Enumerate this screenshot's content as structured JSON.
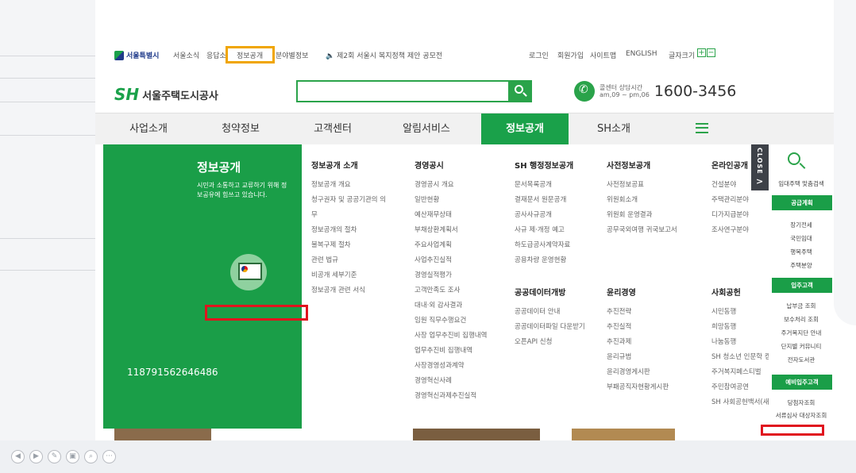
{
  "topbar": {
    "seoul_logo": "서울특별시",
    "links": [
      {
        "label": "서울소식"
      },
      {
        "label": "응답소"
      },
      {
        "label": "정보공개"
      },
      {
        "label": "분야별정보"
      }
    ],
    "notice": "제2회 서울시 복지정책 제안 공모전",
    "util": [
      "로그인",
      "회원가입",
      "사이트맵",
      "ENGLISH",
      "글자크기"
    ],
    "font_plus": "+",
    "font_minus": "−"
  },
  "logo": {
    "mark": "SH",
    "name": "서울주택도시공사"
  },
  "search": {
    "placeholder": ""
  },
  "callcenter": {
    "line1": "콜센터 상담시간",
    "line2": "am,09 ~ pm,06",
    "number": "1600-3456"
  },
  "gnb": {
    "items": [
      {
        "label": "사업소개"
      },
      {
        "label": "청약정보"
      },
      {
        "label": "고객센터"
      },
      {
        "label": "알림서비스"
      },
      {
        "label": "정보공개"
      },
      {
        "label": "SH소개"
      }
    ]
  },
  "mega": {
    "title": "정보공개",
    "desc": "시민과 소통하고 교류하기 위해 정보공유에 힘쓰고 있습니다.",
    "overlay_number": "118791562646486",
    "col1": {
      "head": "정보공개 소개",
      "items": [
        "정보공개 개요",
        "청구권자 및 공공기관의 의",
        "무",
        "정보공개의 절차",
        "불복구제 절차",
        "관련 법규",
        "비공개 세부기준",
        "정보공개 관련 서식"
      ]
    },
    "col2": {
      "head": "경영공시",
      "items": [
        "경영공시 개요",
        "일반현황",
        "예산재무상태",
        "부채상환계획서",
        "주요사업계획",
        "사업추진실적",
        "경영실적평가",
        "고객만족도 조사",
        "대내·외 감사결과",
        "임원 직무수행요건",
        "사장 업무추진비 집행내역",
        "업무추진비 집행내역",
        "사장경영성과계약",
        "경영혁신사례",
        "경영혁신과제추진실적"
      ]
    },
    "col3": {
      "head": "SH 행정정보공개",
      "items": [
        "문서목록공개",
        "결재문서 원문공개",
        "공사사규공개",
        "사규 제·개정 예고",
        "하도급공사계약자료",
        "공용차량 운영현황"
      ],
      "head2": "공공데이터개방",
      "items2": [
        "공공데이터 안내",
        "공공데이터파일 다운받기",
        "오픈API 신청"
      ]
    },
    "col4": {
      "head": "사전정보공개",
      "items": [
        "사전정보공표",
        "위원회소개",
        "위원회 운영결과",
        "공무국외여행 귀국보고서"
      ],
      "head2": "윤리경영",
      "items2": [
        "추진전략",
        "추진실적",
        "추진과제",
        "윤리규범",
        "윤리경영게시판",
        "부패공직자현황게시판"
      ]
    },
    "col5": {
      "head": "온라인공개",
      "items": [
        "건설분야",
        "주택관리분야",
        "디가지급분야",
        "조사연구분야"
      ],
      "head2": "사회공헌",
      "items2": [
        "시민동행",
        "희망동행",
        "나눔동행",
        "SH 청소년 인문학 캠프",
        "주거복지페스티벌",
        "주민참여공연",
        "SH 사회공헌백서(새창)"
      ]
    }
  },
  "close_tab": {
    "label": "CLOSE",
    "arrow": ">"
  },
  "right_side": {
    "search_caption": "임대주택 맞춤검색",
    "sections": [
      {
        "head": "공급계획",
        "items": [
          "장기전세",
          "국민임대",
          "행복주택",
          "주택분양"
        ]
      },
      {
        "head": "입주고객",
        "items": [
          "납부금 조회",
          "보수처리 조회",
          "주거복지단 안내",
          "단지별 커뮤니티",
          "전자도서관"
        ]
      },
      {
        "head": "예비입주고객",
        "items": [
          "당첨자조회",
          "서류심사 대상자조회"
        ]
      }
    ]
  },
  "bottom_controls": [
    "◀",
    "▶",
    "✎",
    "▣",
    "⌕",
    "···"
  ]
}
